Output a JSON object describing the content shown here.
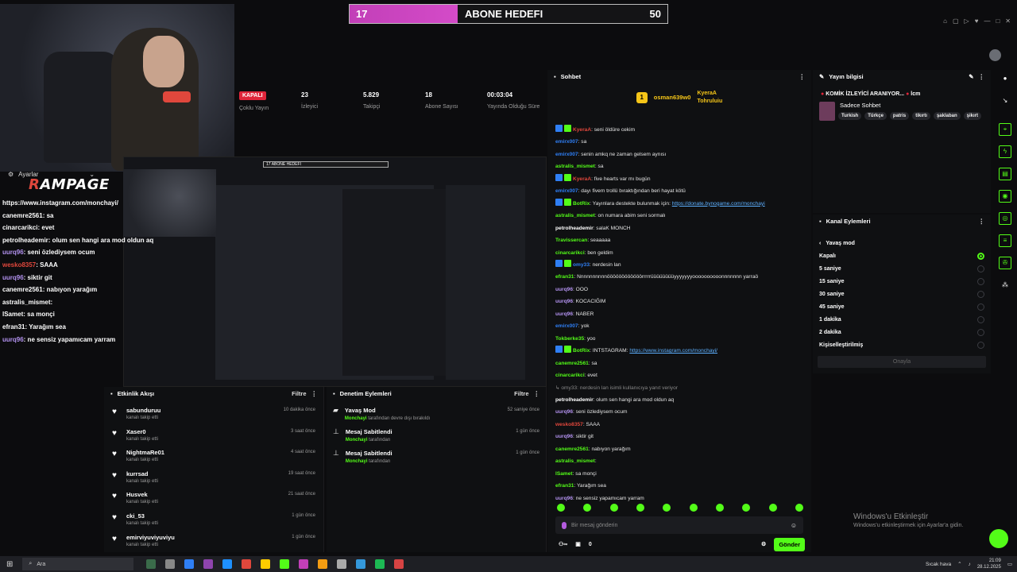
{
  "goal": {
    "current": "17",
    "title": "ABONE HEDEFI",
    "target": "50",
    "progress": 0.34
  },
  "stats": [
    {
      "value": "KAPALI",
      "label": "Çoklu Yayın",
      "is_badge": true
    },
    {
      "value": "23",
      "label": "İzleyici"
    },
    {
      "value": "5.829",
      "label": "Takipçi"
    },
    {
      "value": "18",
      "label": "Abone Sayısı"
    },
    {
      "value": "00:03:04",
      "label": "Yayında Olduğu Süre"
    }
  ],
  "overlay": {
    "settings_label": "Ayarlar",
    "logo": {
      "r": "R",
      "rest": "AMPAGE"
    },
    "lines": [
      {
        "user": "",
        "text": "https://www.instagram.com/monchayi/",
        "color": "#ffffff"
      },
      {
        "user": "canemre2561",
        "text": ": sa",
        "color": "#ffffff"
      },
      {
        "user": "cinarcarikci",
        "text": ": evet",
        "color": "#ffffff"
      },
      {
        "user": "petrolheademir",
        "text": ": olum sen hangi ara mod oldun aq",
        "color": "#ffffff"
      },
      {
        "user": "uurq96",
        "text": ": seni özlediysem ocum",
        "color": "#b392f0"
      },
      {
        "user": "wesko8357",
        "text": ": SAAA",
        "color": "#e0473c"
      },
      {
        "user": "uurq96",
        "text": ": siktir git",
        "color": "#b392f0"
      },
      {
        "user": "canemre2561",
        "text": ": nabıyon yarağım",
        "color": "#ffffff"
      },
      {
        "user": "astralis_mismet",
        "text": ":",
        "color": "#ffffff"
      },
      {
        "user": "lSamet",
        "text": ": sa monçi",
        "color": "#ffffff"
      },
      {
        "user": "efran31",
        "text": ": Yarağım sea",
        "color": "#ffffff"
      },
      {
        "user": "uurq96",
        "text": ": ne sensiz yapamıcam yarram",
        "color": "#b392f0"
      }
    ]
  },
  "activity": {
    "title": "Etkinlik Akışı",
    "filter": "Filtre",
    "items": [
      {
        "name": "sabunduruu",
        "sub": "kanalı takip etti",
        "time": "10 dakika önce"
      },
      {
        "name": "Xaser0",
        "sub": "kanalı takip etti",
        "time": "3 saat önce"
      },
      {
        "name": "NightmaRe01",
        "sub": "kanalı takip etti",
        "time": "4 saat önce"
      },
      {
        "name": "kurrsad",
        "sub": "kanalı takip etti",
        "time": "19 saat önce"
      },
      {
        "name": "Husvek",
        "sub": "kanalı takip etti",
        "time": "21 saat önce"
      },
      {
        "name": "cki_53",
        "sub": "kanalı takip etti",
        "time": "1 gün önce"
      },
      {
        "name": "emirviyuviyuviyu",
        "sub": "kanalı takip etti",
        "time": "1 gün önce"
      }
    ]
  },
  "moderation": {
    "title": "Denetim Eylemleri",
    "filter": "Filtre",
    "items": [
      {
        "name": "Yavaş Mod",
        "actor": "Monchayi",
        "sub": " tarafından devre dışı bırakıldı",
        "time": "52 saniye önce"
      },
      {
        "name": "Mesaj Sabitlendi",
        "actor": "Monchayi",
        "sub": " tarafından",
        "time": "1 gün önce"
      },
      {
        "name": "Mesaj Sabitlendi",
        "actor": "Monchayi",
        "sub": " tarafından",
        "time": "1 gün önce"
      }
    ]
  },
  "chat": {
    "title": "Sohbet",
    "pinned": {
      "first": "osman639w0",
      "second": "KyeraA",
      "third": "Tohruluiu",
      "first_count": "1",
      "third_count": "1"
    },
    "messages": [
      {
        "user": "KyeraA",
        "color": "#e0473c",
        "text": ": seni öldüre cekim",
        "badges": true
      },
      {
        "user": "emirx007",
        "color": "#2f7ff5",
        "text": ": sa"
      },
      {
        "user": "emirx007",
        "color": "#2f7ff5",
        "text": ": senin amkq ne zaman gelsem aynısı"
      },
      {
        "user": "astralis_mismet",
        "color": "#53fc18",
        "text": ": sa"
      },
      {
        "user": "KyeraA",
        "color": "#e0473c",
        "text": ": five hearts var mı bugün",
        "badges": true
      },
      {
        "user": "emirx007",
        "color": "#2f7ff5",
        "text": ": dayı fivem trollü bıraktığından beri hayat kötü"
      },
      {
        "user": "BotRix",
        "color": "#53fc18",
        "text": ": Yayınlara destekte bulunmak için: ",
        "link": "https://donate.bynogame.com/monchayi",
        "badges": true
      },
      {
        "user": "astralis_mismet",
        "color": "#53fc18",
        "text": ": on numara abim seni sormalı"
      },
      {
        "user": "petrolheademir",
        "color": "#ffffff",
        "text": ": salaK MONCH"
      },
      {
        "user": "Travissercan",
        "color": "#53fc18",
        "text": ": seaaaaa"
      },
      {
        "user": "cinarcarikci",
        "color": "#53fc18",
        "text": ": ben geldim"
      },
      {
        "user": "omy33",
        "color": "#2f7ff5",
        "text": ": nerdesin lan",
        "badges": true
      },
      {
        "user": "efran31",
        "color": "#53fc18",
        "text": ": Nnnnnnnnnnöööööööööööörrrrrüüüüüüüüyyyyyyyoooooooooonnnnnnn yarraö"
      },
      {
        "user": "uurq96",
        "color": "#b392f0",
        "text": ": OOO"
      },
      {
        "user": "uurq96",
        "color": "#b392f0",
        "text": ": KOCACIĞIM"
      },
      {
        "user": "uurq96",
        "color": "#b392f0",
        "text": ": NABER"
      },
      {
        "user": "emirx007",
        "color": "#2f7ff5",
        "text": ": yok"
      },
      {
        "user": "Tokberke35",
        "color": "#53fc18",
        "text": ": yoo"
      },
      {
        "user": "BotRix",
        "color": "#53fc18",
        "text": ": INTSTAGRAM: ",
        "link": "https://www.instagram.com/monchayi/",
        "badges": true
      },
      {
        "user": "canemre2561",
        "color": "#53fc18",
        "text": ": sa"
      },
      {
        "user": "cinarcarikci",
        "color": "#53fc18",
        "text": ": evet"
      },
      {
        "user": "",
        "color": "#888888",
        "text": "↳ omy33: nerdesin lan isimli kullanıcıya yanıt veriyor"
      },
      {
        "user": "petrolheademir",
        "color": "#ffffff",
        "text": ": olum sen hangi ara mod oldun aq"
      },
      {
        "user": "uurq96",
        "color": "#b392f0",
        "text": ": seni özlediysem ocum"
      },
      {
        "user": "wesko8357",
        "color": "#e0473c",
        "text": ": SAAA"
      },
      {
        "user": "uurq96",
        "color": "#b392f0",
        "text": ": siktir git"
      },
      {
        "user": "canemre2561",
        "color": "#53fc18",
        "text": ": nabıyon yarağım"
      },
      {
        "user": "astralis_mismet",
        "color": "#53fc18",
        "text": ":"
      },
      {
        "user": "lSamet",
        "color": "#53fc18",
        "text": ": sa monçi"
      },
      {
        "user": "efran31",
        "color": "#53fc18",
        "text": ": Yarağım sea"
      },
      {
        "user": "uurq96",
        "color": "#b392f0",
        "text": ": ne sensiz yapamıcam yarram"
      }
    ],
    "input_placeholder": "Bir mesaj gönderin",
    "count": "0",
    "send_label": "Gönder"
  },
  "stream_info": {
    "title": "Yayın bilgisi",
    "stream_title": "KOMİK İZLEYİCİ ARANIYOR...",
    "stream_title_suffix": "lcm",
    "category": "Sadece Sohbet",
    "tags": [
      "Turkish",
      "Türkçe",
      "patris",
      "tikırtı",
      "şaklaban",
      "şikırt"
    ]
  },
  "channel_actions": {
    "title": "Kanal Eylemleri",
    "back_label": "Yavaş mod",
    "options": [
      "Kapalı",
      "5 saniye",
      "15 saniye",
      "30 saniye",
      "45 saniye",
      "1 dakika",
      "2 dakika",
      "Kişiselleştirilmiş"
    ],
    "selected": 0,
    "confirm_label": "Onayla"
  },
  "watermark": {
    "line1": "Windows'u Etkinleştir",
    "line2": "Windows'u etkinleştirmek için Ayarlar'a gidin."
  },
  "taskbar": {
    "search_placeholder": "Ara",
    "weather": "Sıcak hava",
    "time": "21:09",
    "date": "28.12.2025"
  },
  "colors": {
    "accent": "#53fc18",
    "goal_fill": "#c23fb8",
    "danger": "#e0253a"
  }
}
